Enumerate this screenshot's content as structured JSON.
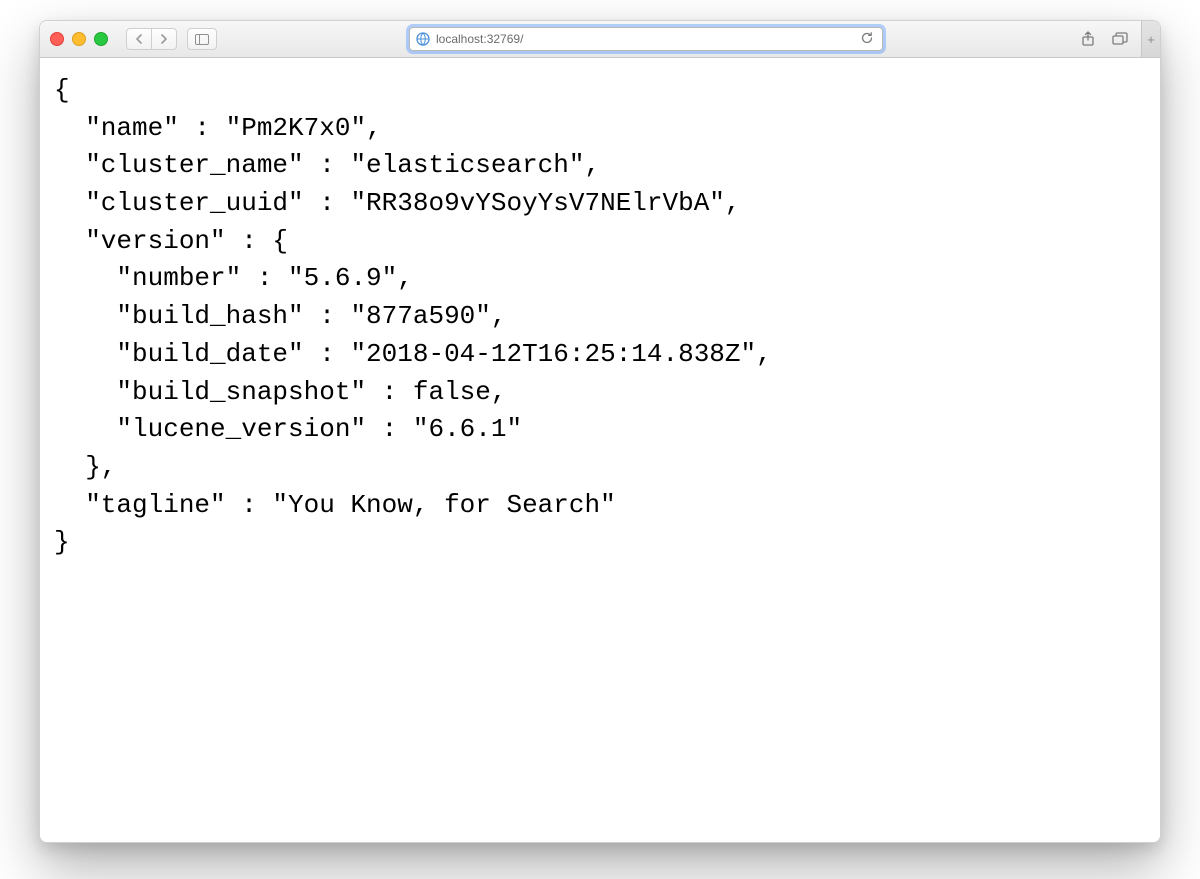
{
  "browser": {
    "address": "localhost:32769/",
    "traffic": {
      "close": "close",
      "min": "minimize",
      "max": "zoom"
    }
  },
  "response": {
    "name": "Pm2K7x0",
    "cluster_name": "elasticsearch",
    "cluster_uuid": "RR38o9vYSoyYsV7NElrVbA",
    "version": {
      "number": "5.6.9",
      "build_hash": "877a590",
      "build_date": "2018-04-12T16:25:14.838Z",
      "build_snapshot": false,
      "lucene_version": "6.6.1"
    },
    "tagline": "You Know, for Search"
  },
  "json_text": "{\n  \"name\" : \"Pm2K7x0\",\n  \"cluster_name\" : \"elasticsearch\",\n  \"cluster_uuid\" : \"RR38o9vYSoyYsV7NElrVbA\",\n  \"version\" : {\n    \"number\" : \"5.6.9\",\n    \"build_hash\" : \"877a590\",\n    \"build_date\" : \"2018-04-12T16:25:14.838Z\",\n    \"build_snapshot\" : false,\n    \"lucene_version\" : \"6.6.1\"\n  },\n  \"tagline\" : \"You Know, for Search\"\n}"
}
